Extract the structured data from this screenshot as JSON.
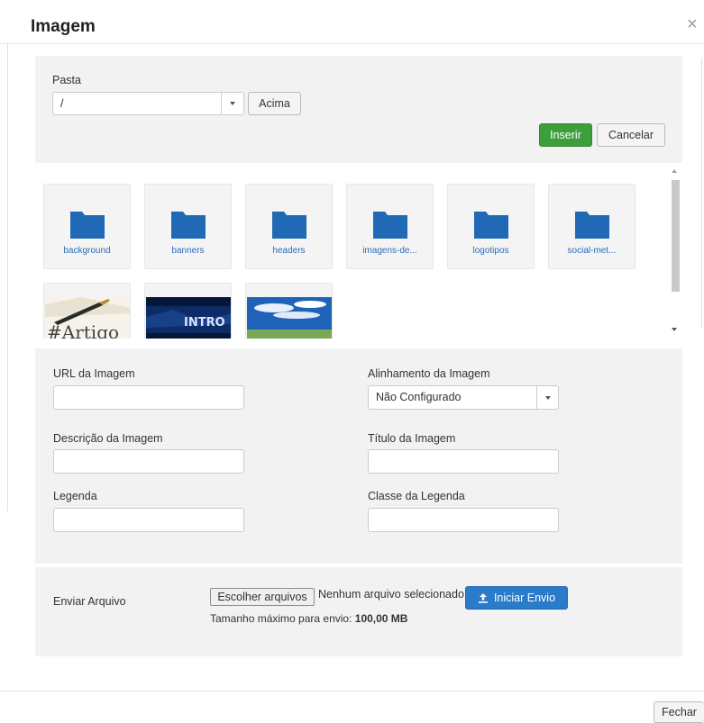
{
  "dialog": {
    "title": "Imagem",
    "close_symbol": "×",
    "footer_close_label": "Fechar"
  },
  "folder_panel": {
    "label": "Pasta",
    "selected": "/",
    "up_label": "Acima",
    "insert_label": "Inserir",
    "cancel_label": "Cancelar"
  },
  "browser": {
    "folders": [
      {
        "name": "background"
      },
      {
        "name": "banners"
      },
      {
        "name": "headers"
      },
      {
        "name": "imagens-de..."
      },
      {
        "name": "logotipos"
      },
      {
        "name": "social-met..."
      }
    ],
    "images": [
      {
        "icon": "article-image-thumbnail"
      },
      {
        "icon": "intro-image-thumbnail",
        "text": "INTRO"
      },
      {
        "icon": "sky-image-thumbnail"
      }
    ]
  },
  "form": {
    "url_label": "URL da Imagem",
    "url_value": "",
    "align_label": "Alinhamento da Imagem",
    "align_value": "Não Configurado",
    "desc_label": "Descrição da Imagem",
    "desc_value": "",
    "title_label": "Título da Imagem",
    "title_value": "",
    "caption_label": "Legenda",
    "caption_value": "",
    "caption_class_label": "Classe da Legenda",
    "caption_class_value": ""
  },
  "upload": {
    "label": "Enviar Arquivo",
    "choose_label": "Escolher arquivos",
    "no_file_text": "Nenhum arquivo selecionado",
    "start_label": "Iniciar Envio",
    "max_text": "Tamanho máximo para envio:",
    "max_value": "100,00 MB"
  },
  "colors": {
    "folder": "#2069b4",
    "success": "#3c9f3c",
    "primary": "#2a7bc9",
    "panel": "#f2f2f2"
  }
}
